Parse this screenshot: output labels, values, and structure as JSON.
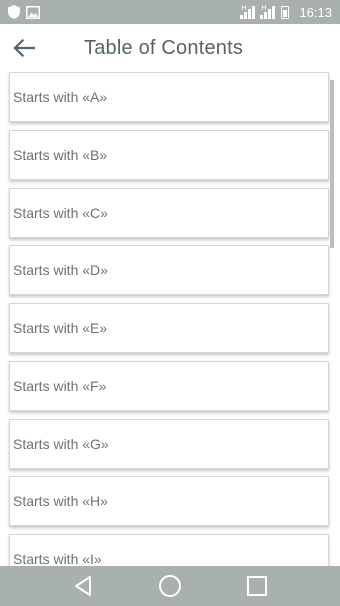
{
  "status_bar": {
    "time": "16:13",
    "sim1_label": "H",
    "sim2_label": "H"
  },
  "app_bar": {
    "title": "Table of Contents",
    "back_icon": "arrow-left-icon"
  },
  "toc": {
    "items": [
      {
        "label": "Starts with «A»"
      },
      {
        "label": "Starts with «B»"
      },
      {
        "label": "Starts with «C»"
      },
      {
        "label": "Starts with «D»"
      },
      {
        "label": "Starts with «E»"
      },
      {
        "label": "Starts with «F»"
      },
      {
        "label": "Starts with «G»"
      },
      {
        "label": "Starts with «H»"
      },
      {
        "label": "Starts with «I»"
      }
    ]
  },
  "nav_bar": {
    "back_icon": "triangle-back-icon",
    "home_icon": "circle-home-icon",
    "recents_icon": "square-recents-icon"
  },
  "colors": {
    "status_bar_bg": "#a9b0b0",
    "title_text": "#55636b",
    "item_text": "#6a737a"
  }
}
